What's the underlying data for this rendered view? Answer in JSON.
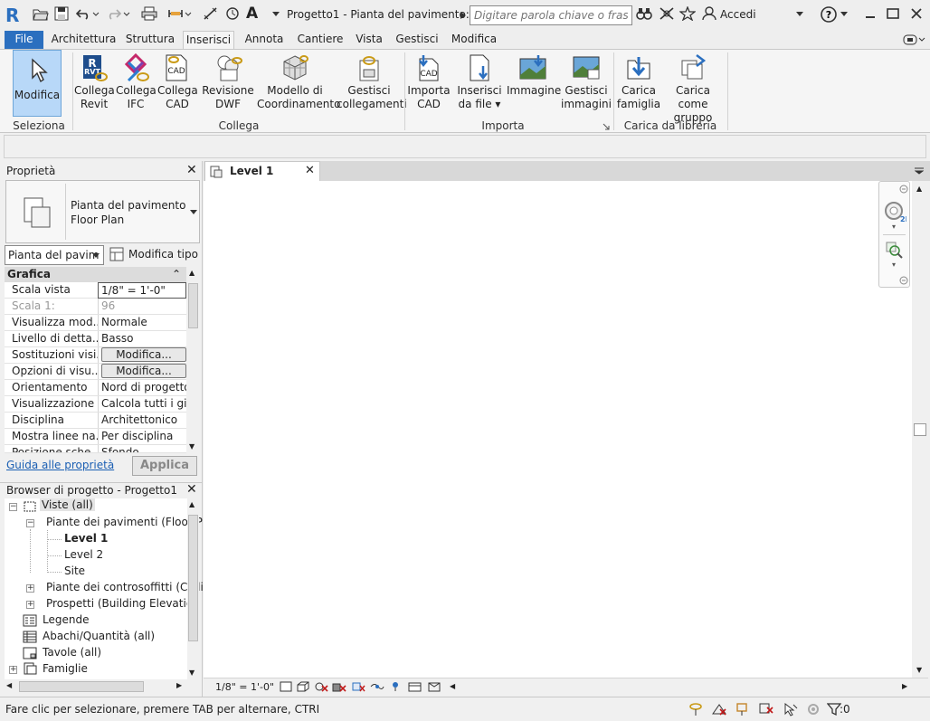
{
  "app": {
    "logo_letter": "R",
    "doc_title": "Progetto1 - Pianta del pavimento:...",
    "search_placeholder": "Digitare parola chiave o frase",
    "login_label": "Accedi",
    "quick_text_tool": "A"
  },
  "menu": {
    "tabs": [
      "File",
      "Architettura",
      "Struttura",
      "Inserisci",
      "Annota",
      "Cantiere",
      "Vista",
      "Gestisci",
      "Modifica"
    ],
    "active": "Inserisci"
  },
  "ribbon": {
    "modifica": "Modifica",
    "seleziona": "Seleziona",
    "buttons": [
      {
        "l1": "Collega",
        "l2": "Revit",
        "icon": "link-revit-icon",
        "badge": "RVT"
      },
      {
        "l1": "Collega",
        "l2": "IFC",
        "icon": "link-ifc-icon",
        "badge": ""
      },
      {
        "l1": "Collega",
        "l2": "CAD",
        "icon": "link-cad-icon",
        "badge": "CAD"
      },
      {
        "l1": "Revisione",
        "l2": "DWF",
        "icon": "dwf-markup-icon",
        "badge": ""
      },
      {
        "l1": "Modello di",
        "l2": "Coordinamento",
        "icon": "coordination-model-icon",
        "badge": ""
      },
      {
        "l1": "Gestisci",
        "l2": "collegamenti",
        "icon": "manage-links-icon",
        "badge": ""
      },
      {
        "l1": "Importa",
        "l2": "CAD",
        "icon": "import-cad-icon",
        "badge": "CAD"
      },
      {
        "l1": "Inserisci",
        "l2": "da file",
        "icon": "insert-from-file-icon",
        "badge": ""
      },
      {
        "l1": "Immagine",
        "l2": "",
        "icon": "image-icon",
        "badge": ""
      },
      {
        "l1": "Gestisci",
        "l2": "immagini",
        "icon": "manage-images-icon",
        "badge": ""
      },
      {
        "l1": "Carica",
        "l2": "famiglia",
        "icon": "load-family-icon",
        "badge": ""
      },
      {
        "l1": "Carica come",
        "l2": "gruppo",
        "icon": "load-as-group-icon",
        "badge": ""
      }
    ],
    "panels": {
      "collega": "Collega",
      "importa": "Importa",
      "libreria": "Carica da libreria"
    }
  },
  "properties": {
    "title": "Proprietà",
    "type_line1": "Pianta del pavimento",
    "type_line2": "Floor Plan",
    "instance_select": "Pianta del pavim",
    "edit_type": "Modifica tipo",
    "section": "Grafica",
    "rows": [
      {
        "k": "Scala vista",
        "v": "1/8\" = 1'-0\""
      },
      {
        "k": "Scala 1:",
        "v": "96"
      },
      {
        "k": "Visualizza mod...",
        "v": "Normale"
      },
      {
        "k": "Livello di detta...",
        "v": "Basso"
      },
      {
        "k": "Sostituzioni visi...",
        "v": "Modifica..."
      },
      {
        "k": "Opzioni di visu...",
        "v": "Modifica..."
      },
      {
        "k": "Orientamento",
        "v": "Nord di progetto"
      },
      {
        "k": "Visualizzazione ...",
        "v": "Calcola tutti i gi..."
      },
      {
        "k": "Disciplina",
        "v": "Architettonico"
      },
      {
        "k": "Mostra linee na...",
        "v": "Per disciplina"
      },
      {
        "k": "Posizione sche...",
        "v": "Sfondo"
      }
    ],
    "help_link": "Guida alle proprietà",
    "apply": "Applica"
  },
  "browser": {
    "title": "Browser di progetto - Progetto1",
    "views": "Viste (all)",
    "floor_plans": "Piante dei pavimenti (Floor Pl",
    "levels": [
      "Level 1",
      "Level 2",
      "Site"
    ],
    "ceiling": "Piante dei controsoffitti (Ceili",
    "elevations": "Prospetti (Building Elevation",
    "legends": "Legende",
    "schedules": "Abachi/Quantità (all)",
    "sheets": "Tavole (all)",
    "families": "Famiglie"
  },
  "view": {
    "tab": "Level 1",
    "scale": "1/8\" = 1'-0\""
  },
  "status": {
    "message": "Fare clic per selezionare, premere TAB per alternare, CTRL per agg",
    "filter_count": ":0"
  },
  "colors": {
    "accent": "#2b6fbf",
    "selected": "#b8d8f8",
    "revit_logo": "#2b6fbf"
  }
}
